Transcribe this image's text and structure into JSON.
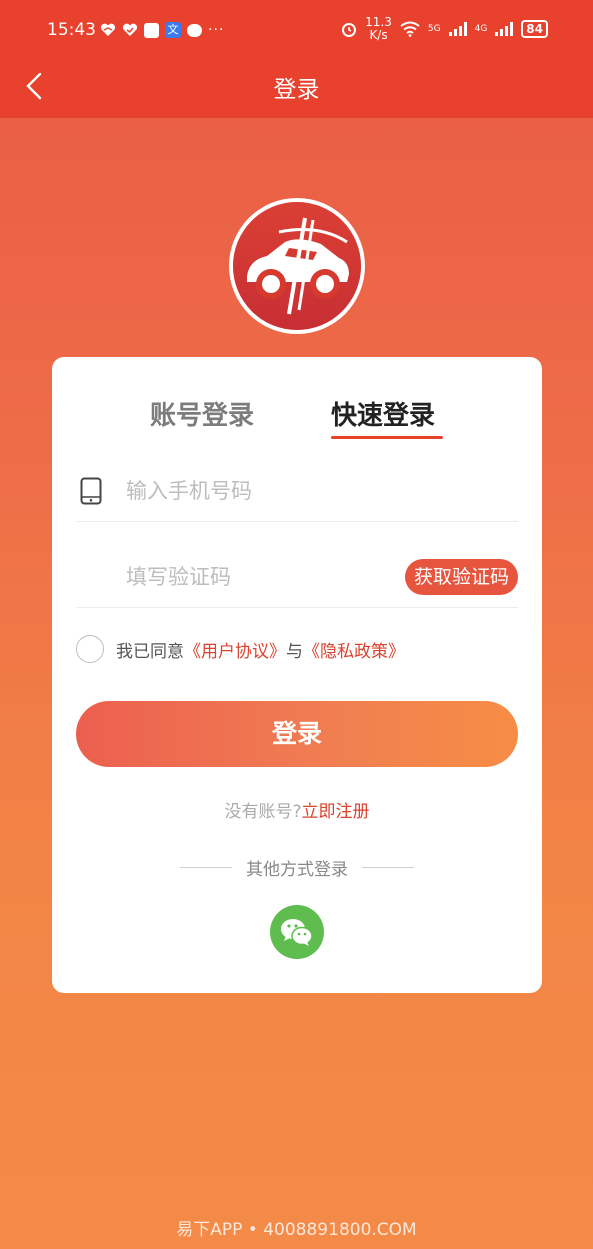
{
  "status_bar": {
    "time": "15:43",
    "net_speed_value": "11.3",
    "net_speed_unit": "K/s",
    "signal1": "5G",
    "signal2": "4G",
    "battery": "84",
    "left_badge": "文",
    "more": "···"
  },
  "nav": {
    "back_icon": "chevron-left-icon",
    "title": "登录"
  },
  "tabs": {
    "account": "账号登录",
    "quick": "快速登录",
    "active": "quick"
  },
  "form": {
    "phone_placeholder": "输入手机号码",
    "phone_value": "",
    "code_placeholder": "填写验证码",
    "code_value": "",
    "get_code_label": "获取验证码"
  },
  "agreement": {
    "prefix": "我已同意",
    "user_agreement": "《用户协议》",
    "and": "与",
    "privacy_policy": "《隐私政策》",
    "checked": false
  },
  "login_button": "登录",
  "register": {
    "question": "没有账号?",
    "link": "立即注册"
  },
  "other_login": {
    "label": "其他方式登录",
    "wechat_icon": "wechat-icon"
  },
  "watermark": "易下APP • 4008891800.COM",
  "colors": {
    "header": "#e8412e",
    "accent": "#d9432f",
    "wechat": "#5fbd4f",
    "background_top": "#e85a45",
    "background_bottom": "#f48a48"
  }
}
